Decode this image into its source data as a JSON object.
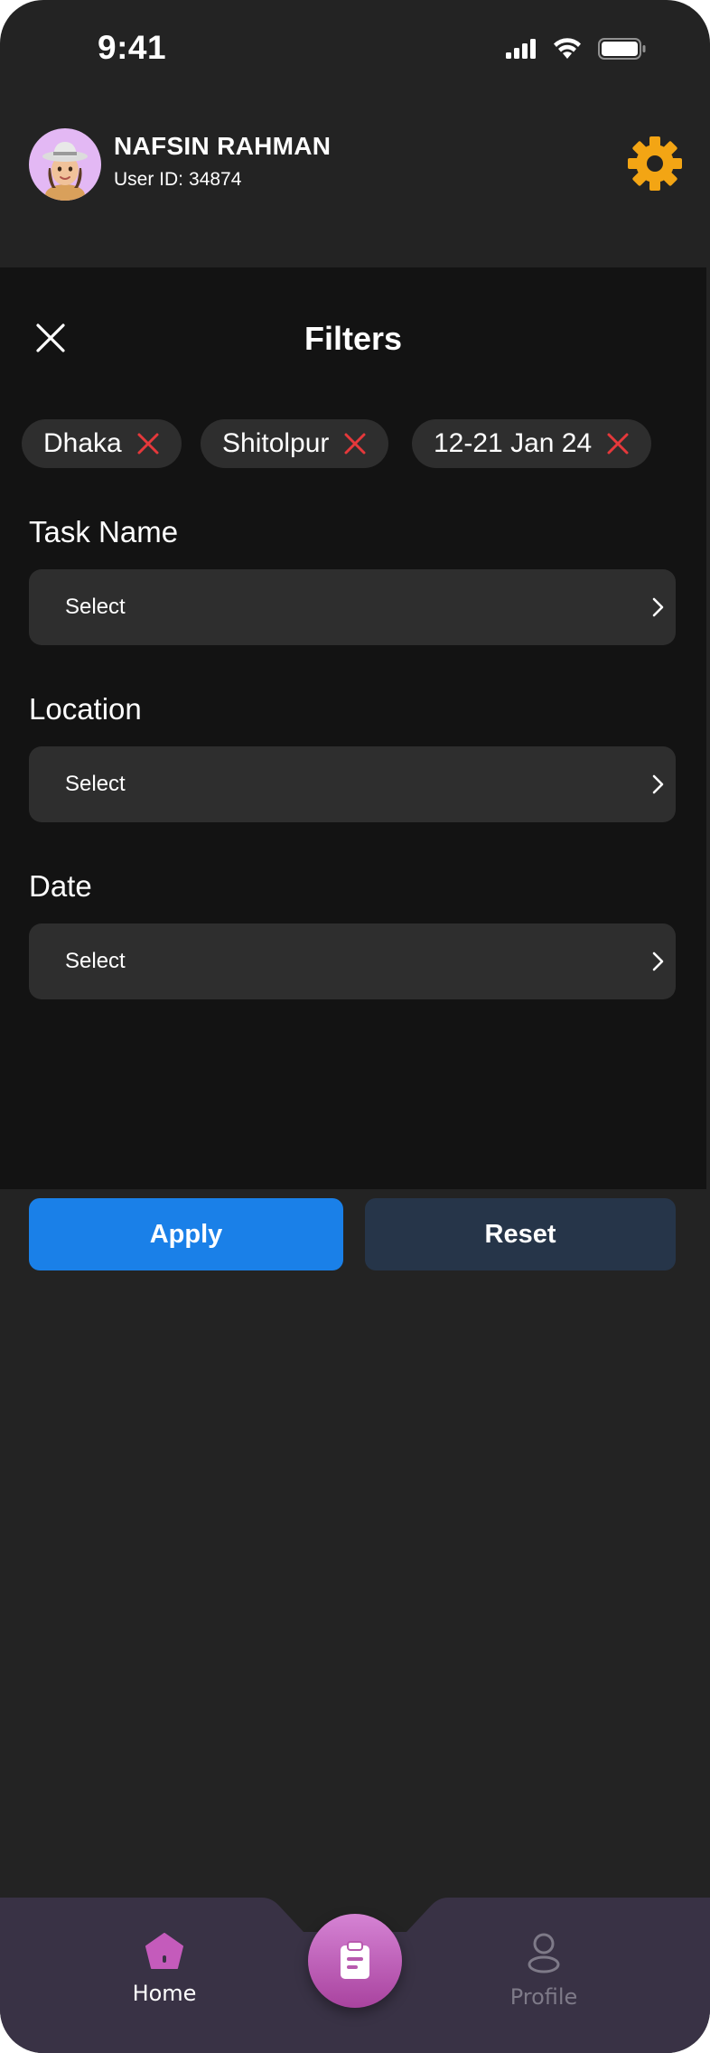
{
  "status_bar": {
    "time": "9:41"
  },
  "header": {
    "user_name": "NAFSIN RAHMAN",
    "user_id_label": "User ID:",
    "user_id": "34874",
    "accent_color": "#f3a514"
  },
  "filters": {
    "title": "Filters",
    "chips": [
      {
        "label": "Dhaka"
      },
      {
        "label": "Shitolpur"
      },
      {
        "label": "12-21 Jan 24"
      }
    ],
    "fields": [
      {
        "label": "Task Name",
        "value": "Select"
      },
      {
        "label": "Location",
        "value": "Select"
      },
      {
        "label": "Date",
        "value": "Select"
      }
    ],
    "apply_label": "Apply",
    "reset_label": "Reset",
    "chip_remove_color": "#e5383b"
  },
  "bottom_nav": {
    "items": [
      {
        "label": "Home",
        "icon": "home-icon",
        "active": true
      },
      {
        "label": "Profile",
        "icon": "user-icon",
        "active": false
      }
    ],
    "center_icon": "clipboard-icon",
    "active_color": "#c45bbb"
  }
}
